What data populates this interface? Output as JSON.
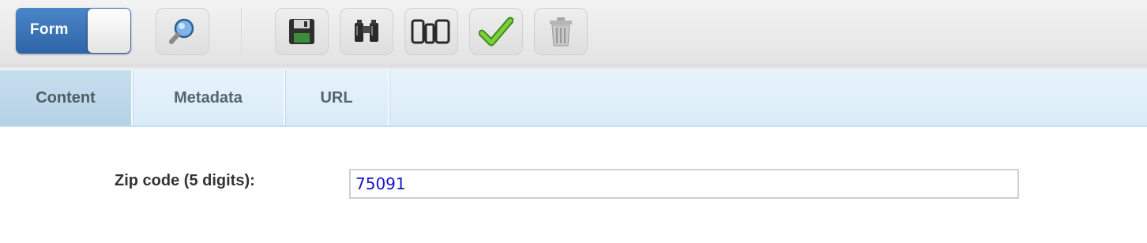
{
  "toolbar": {
    "mode_toggle_label": "Form",
    "buttons": [
      {
        "icon": "magnifier-icon"
      },
      {
        "icon": "floppy-disk-icon"
      },
      {
        "icon": "binoculars-icon"
      },
      {
        "icon": "devices-icon"
      },
      {
        "icon": "checkmark-icon"
      },
      {
        "icon": "trash-icon"
      }
    ],
    "accent_color": "#3a74b9"
  },
  "tabs": [
    {
      "label": "Content",
      "active": true
    },
    {
      "label": "Metadata",
      "active": false
    },
    {
      "label": "URL",
      "active": false
    }
  ],
  "form": {
    "zip_label": "Zip code (5 digits):",
    "zip_value": "75091"
  }
}
